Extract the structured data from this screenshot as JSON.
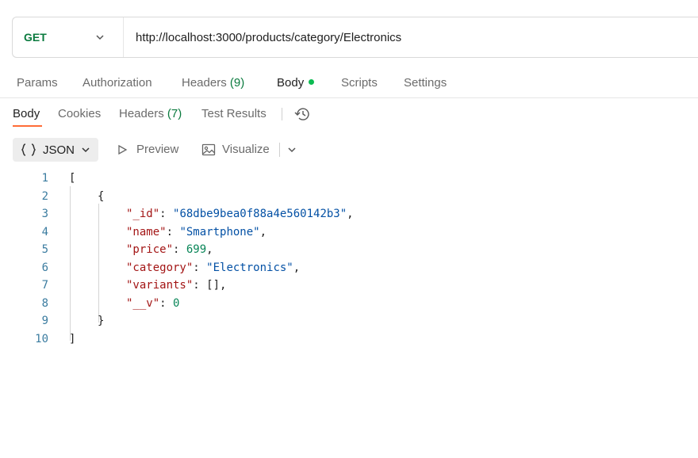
{
  "request": {
    "method": "GET",
    "url": "http://localhost:3000/products/category/Electronics"
  },
  "request_tabs": {
    "params": "Params",
    "authorization": "Authorization",
    "headers_label": "Headers",
    "headers_count": "(9)",
    "body": "Body",
    "scripts": "Scripts",
    "settings": "Settings"
  },
  "response_tabs": {
    "body": "Body",
    "cookies": "Cookies",
    "headers_label": "Headers",
    "headers_count": "(7)",
    "test_results": "Test Results"
  },
  "toolbar": {
    "format": "JSON",
    "preview": "Preview",
    "visualize": "Visualize"
  },
  "response_body": {
    "line_numbers": [
      "1",
      "2",
      "3",
      "4",
      "5",
      "6",
      "7",
      "8",
      "9",
      "10"
    ],
    "open_bracket": "[",
    "open_brace": "{",
    "fields": [
      {
        "key": "\"_id\"",
        "value": "\"68dbe9bea0f88a4e560142b3\"",
        "suffix": ","
      },
      {
        "key": "\"name\"",
        "value": "\"Smartphone\"",
        "suffix": ","
      },
      {
        "key": "\"price\"",
        "value": "699",
        "suffix": ","
      },
      {
        "key": "\"category\"",
        "value": "\"Electronics\"",
        "suffix": ","
      },
      {
        "key": "\"variants\"",
        "value": "[]",
        "suffix": ","
      },
      {
        "key": "\"__v\"",
        "value": "0",
        "suffix": ""
      }
    ],
    "close_brace": "}",
    "close_bracket": "]"
  },
  "colors": {
    "method_green": "#0a7a3e",
    "active_dot": "#0cbb52",
    "active_tab_underline": "#ff6c37",
    "json_key": "#a31515",
    "json_string": "#0451a5",
    "json_number": "#098658"
  },
  "icons": [
    "chevron-down-icon",
    "history-icon",
    "curly-braces-icon",
    "play-icon",
    "image-icon"
  ]
}
